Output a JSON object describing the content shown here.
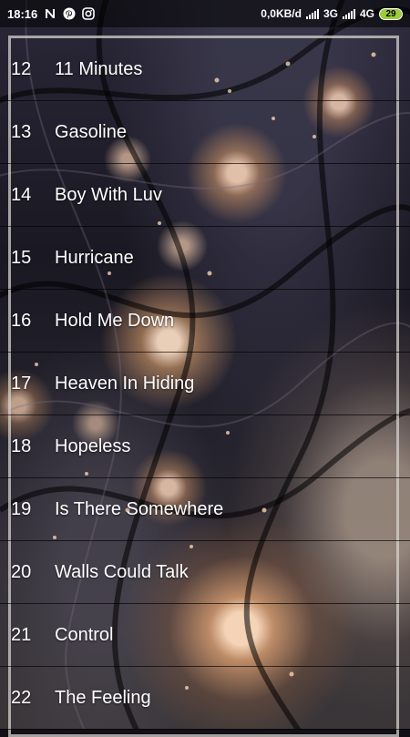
{
  "status_bar": {
    "time": "18:16",
    "notification_icons": [
      "n-app-icon",
      "pinterest-icon",
      "instagram-icon"
    ],
    "network_speed": "0,0KB/d",
    "network_1": "3G",
    "network_2": "4G",
    "battery_level": "29",
    "battery_color": "#9ccc3a"
  },
  "tracks": [
    {
      "number": "12",
      "title": "11 Minutes"
    },
    {
      "number": "13",
      "title": "Gasoline"
    },
    {
      "number": "14",
      "title": "Boy With Luv"
    },
    {
      "number": "15",
      "title": "Hurricane"
    },
    {
      "number": "16",
      "title": "Hold Me Down"
    },
    {
      "number": "17",
      "title": "Heaven In Hiding"
    },
    {
      "number": "18",
      "title": "Hopeless"
    },
    {
      "number": "19",
      "title": "Is There Somewhere"
    },
    {
      "number": "20",
      "title": "Walls Could Talk"
    },
    {
      "number": "21",
      "title": "Control"
    },
    {
      "number": "22",
      "title": "The Feeling"
    }
  ]
}
